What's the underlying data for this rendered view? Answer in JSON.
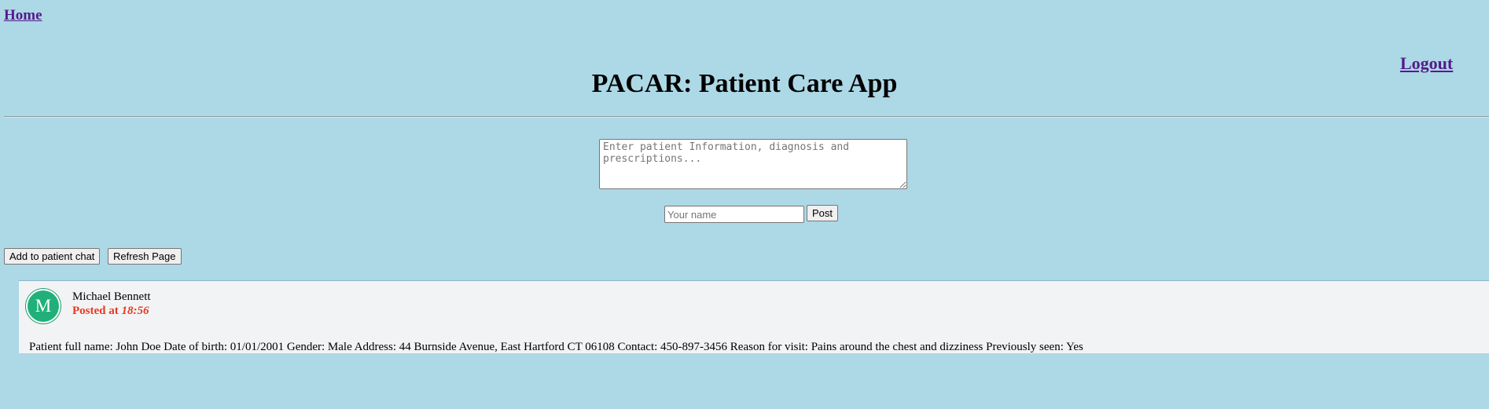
{
  "nav": {
    "home_label": "Home",
    "logout_label": "Logout"
  },
  "header": {
    "title": "PACAR: Patient Care App"
  },
  "form": {
    "info_placeholder": "Enter patient Information, diagnosis and prescriptions...",
    "name_placeholder": "Your name",
    "post_label": "Post"
  },
  "actions": {
    "add_chat_label": "Add to patient chat",
    "refresh_label": "Refresh Page"
  },
  "chat": {
    "messages": [
      {
        "avatar_initial": "M",
        "author": "Michael Bennett",
        "posted_prefix": "Posted at",
        "time": "18:56",
        "text": "Patient full name: John Doe Date of birth: 01/01/2001 Gender: Male Address: 44 Burnside Avenue, East Hartford CT 06108 Contact: 450-897-3456 Reason for visit: Pains around the chest and dizziness Previously seen: Yes"
      }
    ]
  },
  "colors": {
    "page_background": "#add8e6",
    "link": "#551a8b",
    "avatar": "#21b07a",
    "posted_at": "#e63a1f",
    "card_background": "#f2f3f5"
  }
}
